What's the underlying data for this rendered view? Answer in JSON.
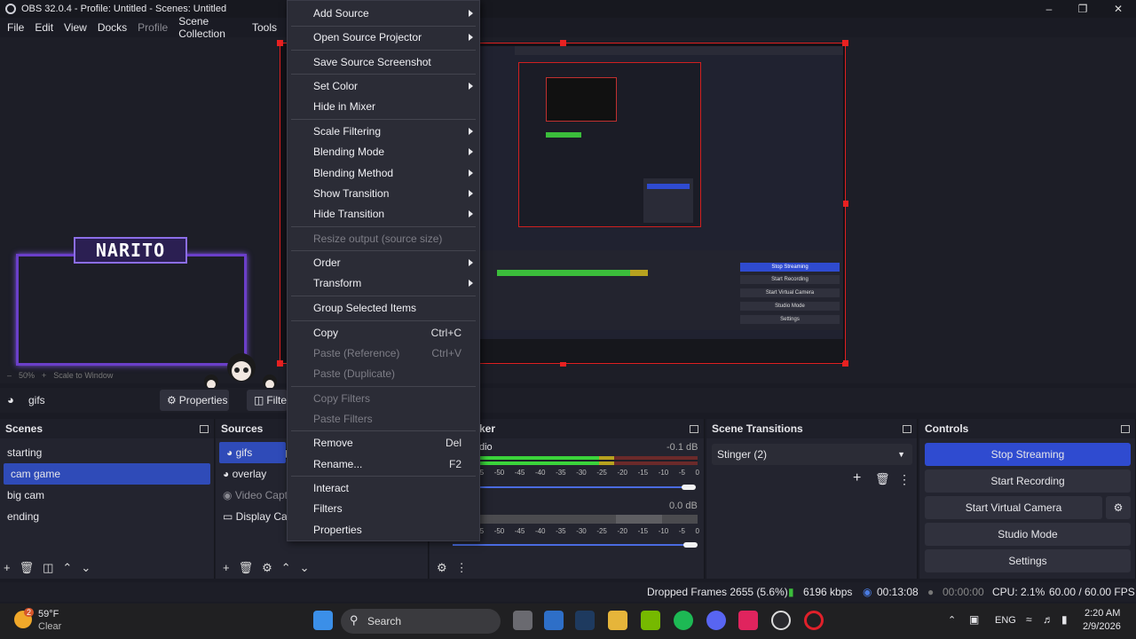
{
  "window": {
    "title": "OBS 32.0.4 - Profile: Untitled - Scenes: Untitled"
  },
  "menubar": {
    "items": [
      "File",
      "Edit",
      "View",
      "Docks",
      "Profile",
      "Scene Collection",
      "Tools"
    ]
  },
  "preview": {
    "overlay_text": "NARITO",
    "zoom": "50%",
    "scale_mode": "Scale to Window"
  },
  "source_toolbar": {
    "selected_source": "gifs",
    "properties_label": "Properties",
    "filters_label": "Filters"
  },
  "scenes": {
    "title": "Scenes",
    "items": [
      "starting",
      "cam game",
      "big cam",
      "ending"
    ],
    "selected": "cam game"
  },
  "sources": {
    "title": "Sources",
    "items": [
      "gifs",
      "overlay",
      "Video Capt",
      "Display Ca"
    ],
    "selected": "gifs"
  },
  "mixer": {
    "title": "ker",
    "channels": [
      {
        "name": "dio",
        "db": "-0.1 dB",
        "level": 0.62
      },
      {
        "name": "",
        "db": "0.0 dB",
        "level": 0.0
      }
    ],
    "scale": [
      "-5",
      "-50",
      "-45",
      "-40",
      "-35",
      "-30",
      "-25",
      "-20",
      "-15",
      "-10",
      "-5",
      "0"
    ]
  },
  "transitions": {
    "title": "Scene Transitions",
    "selected": "Stinger (2)"
  },
  "controls": {
    "title": "Controls",
    "stop_streaming": "Stop Streaming",
    "start_recording": "Start Recording",
    "start_virtual_camera": "Start Virtual Camera",
    "studio_mode": "Studio Mode",
    "settings": "Settings"
  },
  "status": {
    "dropped_frames": "Dropped Frames 2655 (5.6%)",
    "bitrate": "6196 kbps",
    "stream_time": "00:13:08",
    "rec_time": "00:00:00",
    "cpu": "CPU: 2.1%",
    "fps": "60.00 / 60.00 FPS"
  },
  "context_menu": {
    "items": [
      {
        "label": "Add Source",
        "submenu": true
      },
      {
        "label": "Open Source Projector",
        "submenu": true
      },
      {
        "label": "Save Source Screenshot"
      },
      {
        "label": "Set Color",
        "submenu": true
      },
      {
        "label": "Hide in Mixer"
      },
      {
        "label": "Scale Filtering",
        "submenu": true
      },
      {
        "label": "Blending Mode",
        "submenu": true
      },
      {
        "label": "Blending Method",
        "submenu": true
      },
      {
        "label": "Show Transition",
        "submenu": true
      },
      {
        "label": "Hide Transition",
        "submenu": true
      },
      {
        "label": "Resize output (source size)",
        "disabled": true
      },
      {
        "label": "Order",
        "submenu": true
      },
      {
        "label": "Transform",
        "submenu": true
      },
      {
        "label": "Group Selected Items"
      },
      {
        "label": "Copy",
        "shortcut": "Ctrl+C"
      },
      {
        "label": "Paste (Reference)",
        "shortcut": "Ctrl+V",
        "disabled": true
      },
      {
        "label": "Paste (Duplicate)",
        "disabled": true
      },
      {
        "label": "Copy Filters",
        "disabled": true
      },
      {
        "label": "Paste Filters",
        "disabled": true
      },
      {
        "label": "Remove",
        "shortcut": "Del"
      },
      {
        "label": "Rename...",
        "shortcut": "F2"
      },
      {
        "label": "Interact"
      },
      {
        "label": "Filters"
      },
      {
        "label": "Properties"
      }
    ]
  },
  "taskbar": {
    "weather_temp": "59°F",
    "weather_desc": "Clear",
    "weather_badge": "2",
    "search_placeholder": "Search",
    "language": "ENG",
    "time": "2:20 AM",
    "date": "2/9/2026"
  },
  "colors": {
    "accent": "#2f4bd0",
    "selection_red": "#e02020",
    "frame_purple": "#6b3fc9"
  }
}
